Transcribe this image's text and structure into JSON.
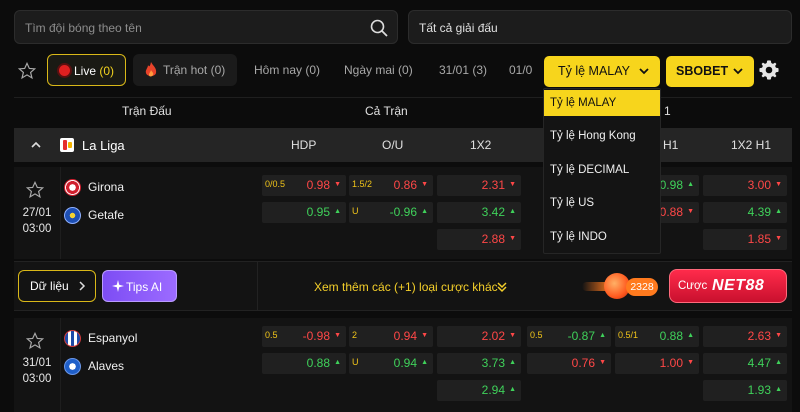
{
  "search": {
    "placeholder": "Tìm đội bóng theo tên"
  },
  "league_filter": {
    "value": "Tất cả giải đấu"
  },
  "tabs": {
    "live_label": "Live",
    "live_count": "(0)",
    "hot": "Trận hot (0)",
    "today": "Hôm nay (0)",
    "tomorrow": "Ngày mai (0)",
    "d3101": "31/01 (3)",
    "more": "01/0"
  },
  "odds_type": {
    "selected": "Tỷ lệ MALAY"
  },
  "bookmaker": {
    "selected": "SBOBET"
  },
  "dropdown": {
    "items": [
      "Tỷ lệ MALAY",
      "Tỷ lệ Hong Kong",
      "Tỷ lệ DECIMAL",
      "Tỷ lệ US",
      "Tỷ lệ INDO"
    ]
  },
  "columns": {
    "match": "Trận Đấu",
    "full": "Cả Trận",
    "half_partial": "1"
  },
  "league": {
    "name": "La Liga",
    "headers": {
      "hdp": "HDP",
      "ou": "O/U",
      "x12": "1X2",
      "h1": "H1",
      "x12h1": "1X2 H1"
    }
  },
  "matches": [
    {
      "date": "27/01",
      "time": "03:00",
      "home": "Girona",
      "away": "Getafe",
      "hdp": {
        "line": "0/0.5",
        "home": "0.98",
        "away": "0.95"
      },
      "ou": {
        "line": "1.5/2",
        "sub": "U",
        "over": "0.86",
        "under": "-0.96"
      },
      "x12": [
        "2.31",
        "3.42",
        "2.88"
      ],
      "h1_hdp": {
        "home": "-0.98",
        "away": "0.88"
      },
      "x12h1": [
        "3.00",
        "4.39",
        "1.85"
      ]
    },
    {
      "date": "31/01",
      "time": "03:00",
      "home": "Espanyol",
      "away": "Alaves",
      "hdp": {
        "line": "0.5",
        "home": "-0.98",
        "away": "0.88"
      },
      "ou": {
        "line": "2",
        "sub": "U",
        "over": "0.94",
        "under": "0.94"
      },
      "x12": [
        "2.02",
        "3.73",
        "2.94"
      ],
      "h1_hdp": {
        "line": "0.5",
        "home": "-0.87",
        "away": "0.76"
      },
      "h1_ou": {
        "line": "0.5/1",
        "over": "0.88",
        "under": "1.00"
      },
      "x12h1": [
        "2.63",
        "4.47",
        "1.93"
      ]
    }
  ],
  "actions": {
    "data": "Dữ liệu",
    "tips": "Tips AI",
    "more_bets": "Xem thêm các (+1) loại cược khác"
  },
  "ads": {
    "promo_number": "2328",
    "cta_label": "Cược",
    "brand": "NET88"
  },
  "colors": {
    "accent": "#f7d51c",
    "up": "#3fd15a",
    "down": "#ff4747",
    "tips": "#8a5cf6",
    "ad": "#e61e3c"
  }
}
